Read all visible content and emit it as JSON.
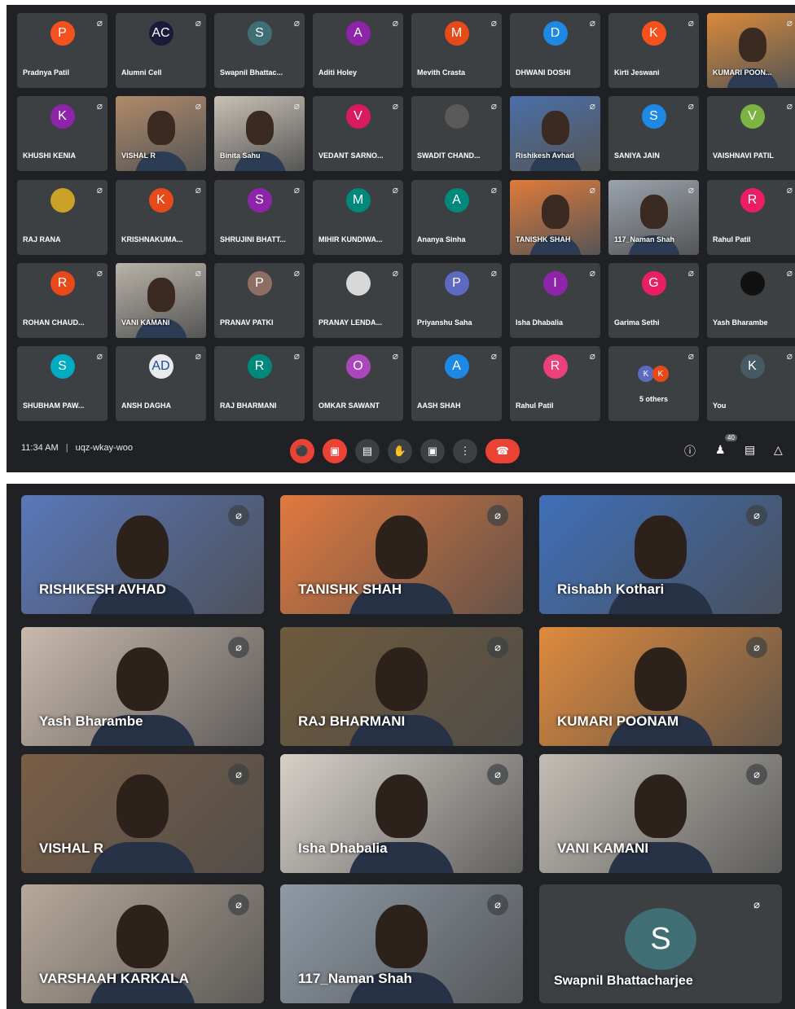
{
  "top_grid": {
    "tiles": [
      {
        "name": "Pradnya Patil",
        "initial": "P",
        "color": "#f4511e",
        "type": "avatar"
      },
      {
        "name": "Alumni Cell",
        "initial": "AC",
        "color": "#1a1a3a",
        "type": "avatar"
      },
      {
        "name": "Swapnil Bhattac...",
        "initial": "S",
        "color": "#3f6e74",
        "type": "avatar"
      },
      {
        "name": "Aditi Holey",
        "initial": "A",
        "color": "#8e24aa",
        "type": "avatar"
      },
      {
        "name": "Mevith Crasta",
        "initial": "M",
        "color": "#e64a19",
        "type": "avatar"
      },
      {
        "name": "DHWANI DOSHI",
        "initial": "D",
        "color": "#1e88e5",
        "type": "avatar"
      },
      {
        "name": "Kirti Jeswani",
        "initial": "K",
        "color": "#f4511e",
        "type": "avatar"
      },
      {
        "name": "KUMARI POON...",
        "initial": "",
        "color": "#d98a3a",
        "type": "video"
      },
      {
        "name": "KHUSHI KENIA",
        "initial": "K",
        "color": "#8e24aa",
        "type": "avatar"
      },
      {
        "name": "VISHAL R",
        "initial": "",
        "color": "#b08a6a",
        "type": "video"
      },
      {
        "name": "Binita Sahu",
        "initial": "",
        "color": "#c9c0b5",
        "type": "video"
      },
      {
        "name": "VEDANT SARNO...",
        "initial": "V",
        "color": "#d81b60",
        "type": "avatar"
      },
      {
        "name": "SWADIT CHAND...",
        "initial": "",
        "color": "#5a5a5a",
        "type": "avatar"
      },
      {
        "name": "Rishikesh Avhad",
        "initial": "",
        "color": "#4a6fa8",
        "type": "video"
      },
      {
        "name": "SANIYA JAIN",
        "initial": "S",
        "color": "#1e88e5",
        "type": "avatar"
      },
      {
        "name": "VAISHNAVI PATIL",
        "initial": "V",
        "color": "#7cb342",
        "type": "avatar"
      },
      {
        "name": "RAJ RANA",
        "initial": "",
        "color": "#c9a227",
        "type": "avatar"
      },
      {
        "name": "KRISHNAKUMA...",
        "initial": "K",
        "color": "#e64a19",
        "type": "avatar"
      },
      {
        "name": "SHRUJINI BHATT...",
        "initial": "S",
        "color": "#8e24aa",
        "type": "avatar"
      },
      {
        "name": "MIHIR KUNDIWA...",
        "initial": "M",
        "color": "#00897b",
        "type": "avatar"
      },
      {
        "name": "Ananya Sinha",
        "initial": "A",
        "color": "#00897b",
        "type": "avatar"
      },
      {
        "name": "TANISHK SHAH",
        "initial": "",
        "color": "#e07a3a",
        "type": "video"
      },
      {
        "name": "117_Naman Shah",
        "initial": "",
        "color": "#9aa3ad",
        "type": "video"
      },
      {
        "name": "Rahul Patil",
        "initial": "R",
        "color": "#e91e63",
        "type": "avatar"
      },
      {
        "name": "ROHAN CHAUD...",
        "initial": "R",
        "color": "#e64a19",
        "type": "avatar"
      },
      {
        "name": "VANI KAMANI",
        "initial": "",
        "color": "#b9b3a8",
        "type": "video"
      },
      {
        "name": "PRANAV PATKI",
        "initial": "P",
        "color": "#8d6e63",
        "type": "avatar"
      },
      {
        "name": "PRANAY LENDA...",
        "initial": "",
        "color": "#d8d8d8",
        "type": "avatar"
      },
      {
        "name": "Priyanshu Saha",
        "initial": "P",
        "color": "#5c6bc0",
        "type": "avatar"
      },
      {
        "name": "Isha Dhabalia",
        "initial": "I",
        "color": "#8e24aa",
        "type": "avatar"
      },
      {
        "name": "Garima Sethi",
        "initial": "G",
        "color": "#e91e63",
        "type": "avatar"
      },
      {
        "name": "Yash Bharambe",
        "initial": "",
        "color": "#111111",
        "type": "avatar"
      },
      {
        "name": "SHUBHAM PAW...",
        "initial": "S",
        "color": "#00acc1",
        "type": "avatar"
      },
      {
        "name": "ANSH DAGHA",
        "initial": "AD",
        "color": "#e8eaed",
        "type": "avatar"
      },
      {
        "name": "RAJ BHARMANI",
        "initial": "R",
        "color": "#00897b",
        "type": "avatar"
      },
      {
        "name": "OMKAR SAWANT",
        "initial": "O",
        "color": "#ab47bc",
        "type": "avatar"
      },
      {
        "name": "AASH SHAH",
        "initial": "A",
        "color": "#1e88e5",
        "type": "avatar"
      },
      {
        "name": "Rahul Patil",
        "initial": "R",
        "color": "#ec407a",
        "type": "avatar"
      },
      {
        "name": "5 others",
        "initial": "",
        "color": "#3c4043",
        "type": "others"
      },
      {
        "name": "You",
        "initial": "K",
        "color": "#455a64",
        "type": "avatar"
      }
    ],
    "others_initials": [
      "K",
      "K"
    ],
    "others_colors": [
      "#5c6bc0",
      "#e64a19"
    ]
  },
  "controls": {
    "time": "11:34 AM",
    "separator": "|",
    "meeting_code": "uqz-wkay-woo",
    "people_count": "40"
  },
  "bottom_grid": {
    "tiles": [
      {
        "name": "RISHIKESH AVHAD",
        "bg": "#5a77b8",
        "type": "video"
      },
      {
        "name": "TANISHK SHAH",
        "bg": "#e0793f",
        "type": "video"
      },
      {
        "name": "Rishabh Kothari",
        "bg": "#3f6fb8",
        "type": "video"
      },
      {
        "name": "Yash Bharambe",
        "bg": "#c9b9ad",
        "type": "video"
      },
      {
        "name": "RAJ BHARMANI",
        "bg": "#6e5a3c",
        "type": "video"
      },
      {
        "name": "KUMARI POONAM",
        "bg": "#de8a3d",
        "type": "video"
      },
      {
        "name": "VISHAL R",
        "bg": "#7a5e46",
        "type": "video"
      },
      {
        "name": "Isha Dhabalia",
        "bg": "#d6d0c8",
        "type": "video"
      },
      {
        "name": "VANI KAMANI",
        "bg": "#c2bdb4",
        "type": "video"
      },
      {
        "name": "VARSHAAH KARKALA",
        "bg": "#b7a99a",
        "type": "video"
      },
      {
        "name": "117_Naman Shah",
        "bg": "#8e9aa6",
        "type": "video"
      },
      {
        "name": "Swapnil Bhattacharjee",
        "bg": "#3c4043",
        "type": "avatar",
        "initial": "S"
      }
    ]
  }
}
